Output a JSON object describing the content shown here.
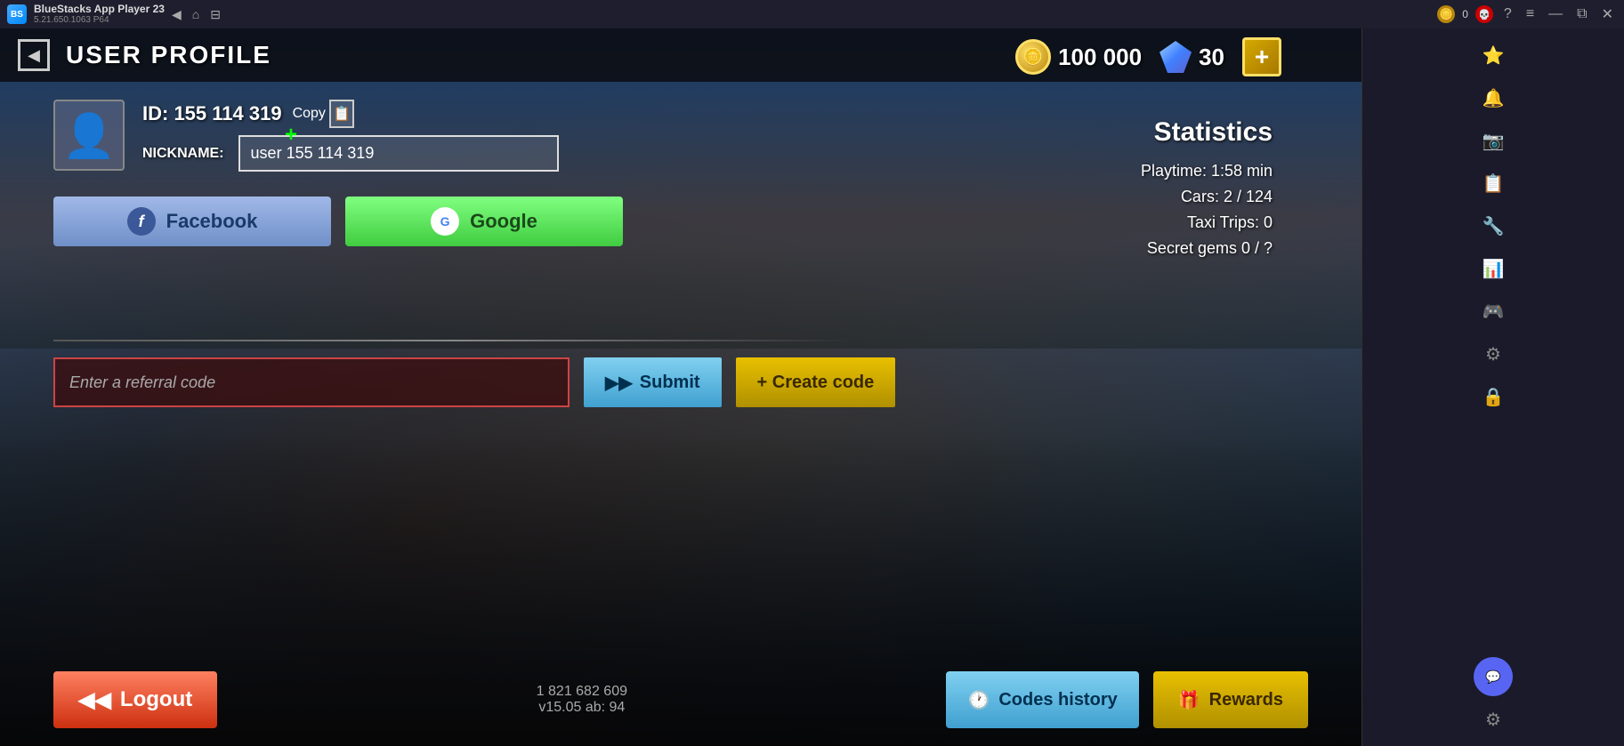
{
  "titlebar": {
    "app_name": "BlueStacks App Player 23",
    "version": "5.21.650.1063 P64",
    "coin_count": "0",
    "nav": {
      "back": "◀",
      "home": "⌂",
      "forward": "⊟"
    },
    "window_controls": {
      "minimize": "—",
      "restore": "⧉",
      "close": "✕"
    }
  },
  "header": {
    "back_label": "◀",
    "title": "USER PROFILE"
  },
  "currency": {
    "coins": "100 000",
    "diamonds": "30",
    "plus_label": "+"
  },
  "profile": {
    "id_label": "ID: 155 114 319",
    "copy_label": "Copy",
    "nickname_label": "NICKNAME:",
    "nickname_value": "user 155 114 319",
    "nickname_placeholder": "user 155 114 319",
    "facebook_label": "Facebook",
    "google_label": "Google"
  },
  "referral": {
    "input_placeholder": "Enter a referral code",
    "submit_label": "Submit",
    "create_code_label": "+ Create code"
  },
  "statistics": {
    "title": "Statistics",
    "playtime_label": "Playtime: 1:58 min",
    "cars_label": "Cars: 2 / 124",
    "taxi_trips_label": "Taxi Trips: 0",
    "secret_gems_label": "Secret gems 0 / ?"
  },
  "bottom": {
    "logout_label": "Logout",
    "version_line1": "1 821 682 609",
    "version_line2": "v15.05 ab: 94",
    "codes_history_label": "Codes history",
    "rewards_label": "Rewards"
  },
  "sidebar": {
    "icons": [
      "⭐",
      "🔔",
      "📷",
      "📋",
      "🔧",
      "📊",
      "🎮",
      "⚙",
      "🔒",
      "💬",
      "⚙"
    ]
  }
}
